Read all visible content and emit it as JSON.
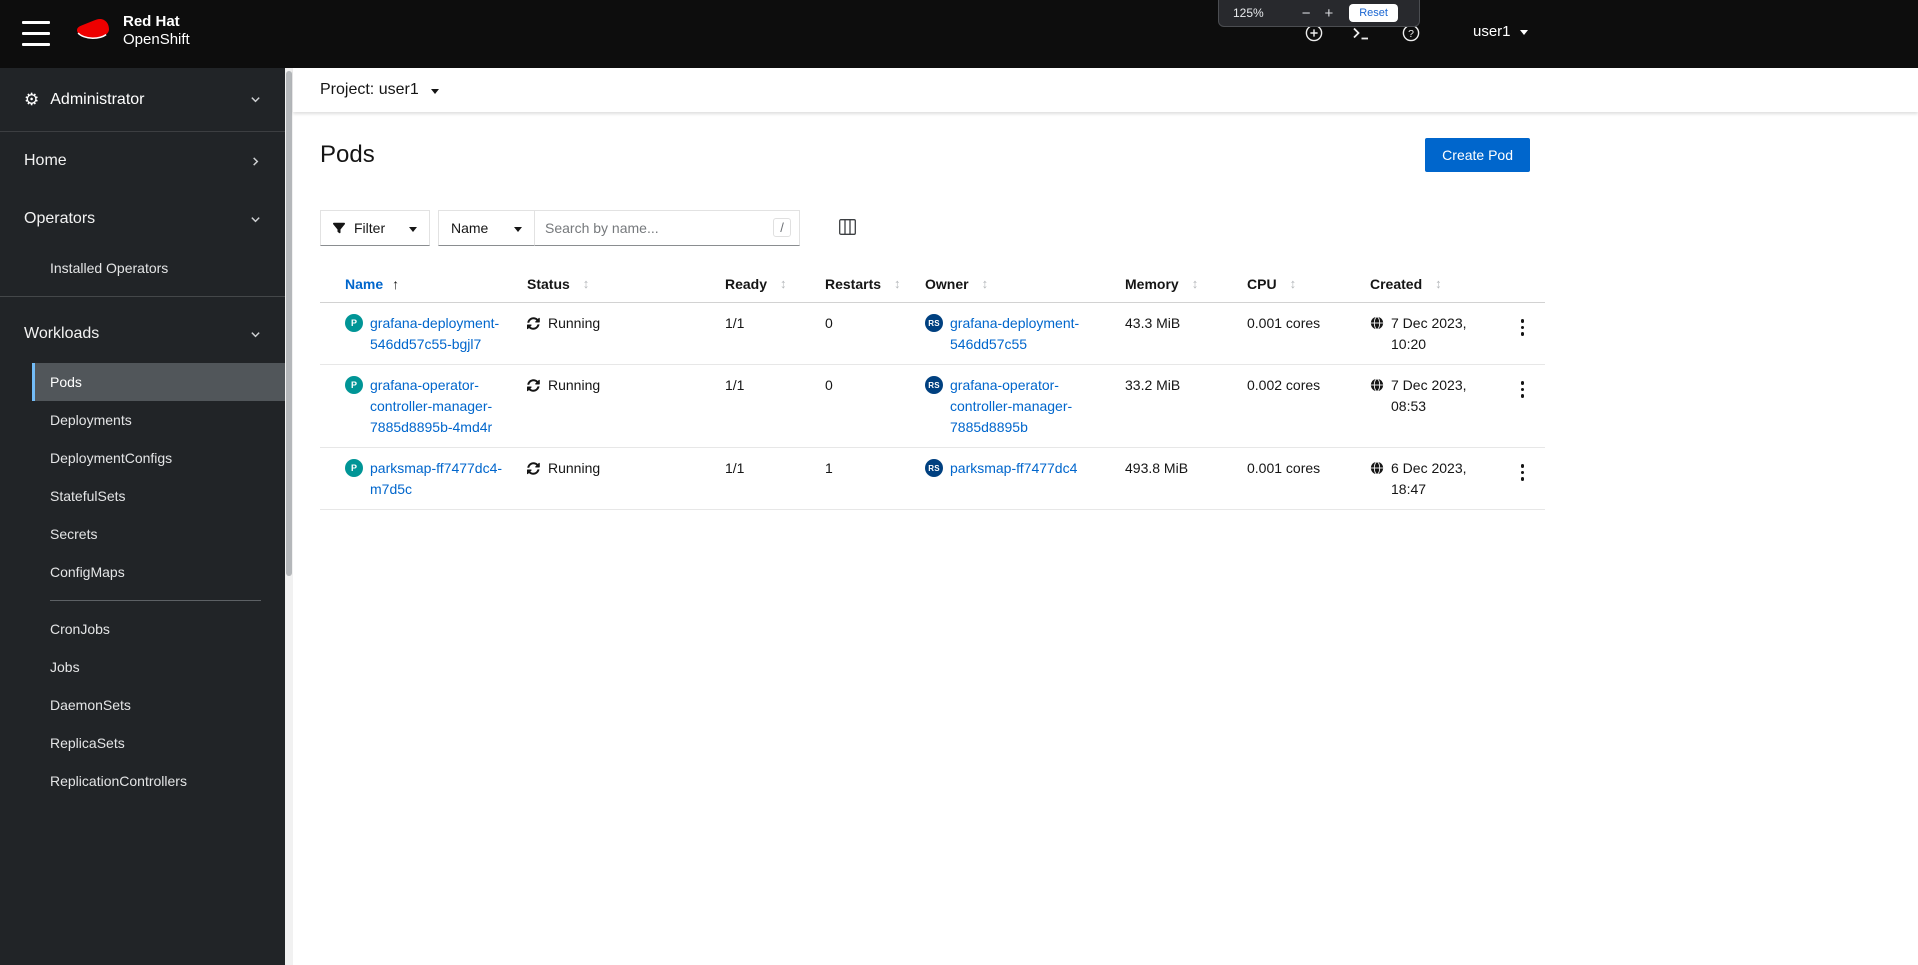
{
  "masthead": {
    "brand": {
      "line1": "Red Hat",
      "line2": "OpenShift"
    },
    "user": "user1"
  },
  "zoom_popup": {
    "level": "125%",
    "minus": "−",
    "plus": "+",
    "reset": "Reset"
  },
  "icons": {
    "gear": "⚙",
    "sort_ascending": "↑",
    "sortable": "↕",
    "help": "?"
  },
  "sidebar": {
    "perspective": "Administrator",
    "home": "Home",
    "operators": {
      "label": "Operators",
      "items": [
        "Installed Operators"
      ]
    },
    "workloads": {
      "label": "Workloads",
      "items": [
        "Pods",
        "Deployments",
        "DeploymentConfigs",
        "StatefulSets",
        "Secrets",
        "ConfigMaps",
        "CronJobs",
        "Jobs",
        "DaemonSets",
        "ReplicaSets",
        "ReplicationControllers"
      ],
      "active_item": "Pods"
    }
  },
  "project_bar": {
    "label": "Project: user1"
  },
  "page": {
    "title": "Pods",
    "create_button": "Create Pod"
  },
  "toolbar": {
    "filter": "Filter",
    "attribute": "Name",
    "search_placeholder": "Search by name...",
    "shortcut_hint": "/"
  },
  "table": {
    "columns": [
      "Name",
      "Status",
      "Ready",
      "Restarts",
      "Owner",
      "Memory",
      "CPU",
      "Created"
    ],
    "sorted_by": "Name",
    "sort_direction": "ascending",
    "rows": [
      {
        "badge": "P",
        "name": "grafana-deployment-546dd57c55-bgjl7",
        "status": "Running",
        "ready": "1/1",
        "restarts": "0",
        "owner_badge": "RS",
        "owner": "grafana-deployment-546dd57c55",
        "memory": "43.3 MiB",
        "cpu": "0.001 cores",
        "created": "7 Dec 2023, 10:20"
      },
      {
        "badge": "P",
        "name": "grafana-operator-controller-manager-7885d8895b-4md4r",
        "status": "Running",
        "ready": "1/1",
        "restarts": "0",
        "owner_badge": "RS",
        "owner": "grafana-operator-controller-manager-7885d8895b",
        "memory": "33.2 MiB",
        "cpu": "0.002 cores",
        "created": "7 Dec 2023, 08:53"
      },
      {
        "badge": "P",
        "name": "parksmap-ff7477dc4-m7d5c",
        "status": "Running",
        "ready": "1/1",
        "restarts": "1",
        "owner_badge": "RS",
        "owner": "parksmap-ff7477dc4",
        "memory": "493.8 MiB",
        "cpu": "0.001 cores",
        "created": "6 Dec 2023, 18:47"
      }
    ]
  },
  "colors": {
    "masthead_bg": "#0d0d0d",
    "sidebar_bg": "#212427",
    "link": "#0066cc",
    "primary_button": "#0066cc",
    "nav_active_indicator": "#73bcf7",
    "pod_badge": "#009596",
    "replicaset_badge": "#004080",
    "brand_red": "#ee0000"
  }
}
